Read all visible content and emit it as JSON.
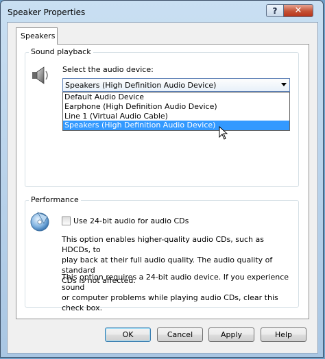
{
  "window": {
    "title": "Speaker Properties",
    "help_glyph": "?",
    "close_glyph": "✕"
  },
  "tabs": [
    {
      "label": "Speakers"
    }
  ],
  "sound_playback": {
    "group_label": "Sound playback",
    "select_label": "Select the audio device:",
    "selected_device": "Speakers (High Definition Audio Device)",
    "options": [
      "Default Audio Device",
      "Earphone (High Definition Audio Device)",
      "Line 1 (Virtual Audio Cable)",
      "Speakers (High Definition Audio Device)"
    ]
  },
  "performance": {
    "group_label": "Performance",
    "checkbox_label": "Use 24-bit audio for audio CDs",
    "checked": false,
    "description_lines_1": [
      "This option enables higher-quality audio CDs, such as HDCDs, to",
      "play back at their full audio quality. The audio quality of standard",
      "CDs is not affected."
    ],
    "description_lines_2": [
      "This option requires a 24-bit audio device. If you experience sound",
      "or computer problems while playing audio CDs, clear this check box."
    ]
  },
  "buttons": {
    "ok": "OK",
    "cancel": "Cancel",
    "apply": "Apply",
    "help": "Help"
  },
  "icons": {
    "speaker": "speaker-icon",
    "cd": "cd-icon"
  }
}
